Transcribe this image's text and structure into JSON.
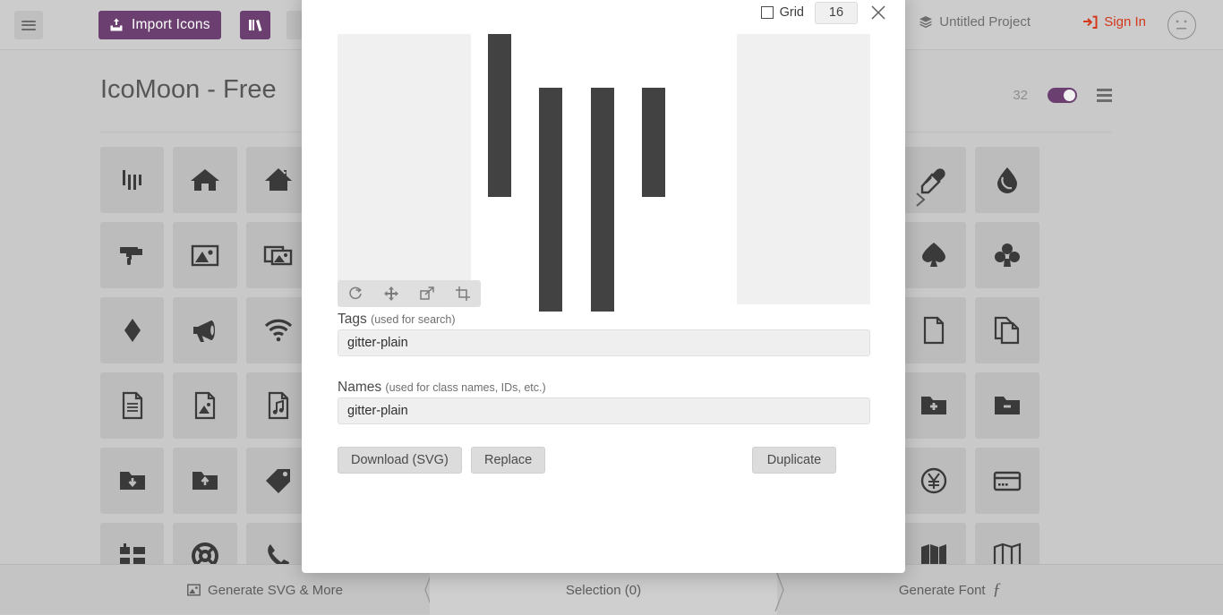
{
  "toolbar": {
    "menu_icon": "hamburger-menu-icon",
    "import_label": "Import Icons",
    "import_icon": "upload-box-icon",
    "library_icon": "books-library-icon",
    "project_label": "Untitled Project",
    "project_icon": "layers-icon",
    "signin_label": "Sign In",
    "signin_icon": "login-arrow-icon",
    "avatar_icon": "neutral-face-avatar-icon"
  },
  "set": {
    "title": "IcoMoon - Free",
    "grid_size": "32",
    "toggle_state": "on",
    "list_icon": "list-view-icon"
  },
  "icon_grid": {
    "left_icons": [
      "gitter-plain-icon",
      "home-icon",
      "home2-icon",
      "paint-roller-icon",
      "image-icon",
      "images-icon",
      "diamond-icon",
      "bullhorn-icon",
      "connection-wifi-icon",
      "file-text-icon",
      "file-picture-icon",
      "file-music-icon",
      "folder-download-icon",
      "folder-upload-icon",
      "price-tag-icon",
      "list-numbered-icon",
      "support-lifebuoy-icon",
      "phone-icon"
    ],
    "right_icons": [
      "eyedropper-icon",
      "droplet-icon",
      "spades-icon",
      "clubs-icon",
      "file-empty-icon",
      "files-empty-icon",
      "folder-plus-icon",
      "folder-minus-icon",
      "yen-coin-icon",
      "credit-card-icon",
      "map-filled-icon",
      "map-outline-icon"
    ]
  },
  "bottombar": {
    "generate_svg_label": "Generate SVG & More",
    "generate_svg_icon": "image-icon",
    "selection_label": "Selection (0)",
    "generate_font_label": "Generate Font",
    "generate_font_icon": "font-f-icon"
  },
  "modal": {
    "grid_checkbox_label": "Grid",
    "grid_checkbox_checked": false,
    "grid_value": "16",
    "close_icon": "close-x-icon",
    "next_icon": "chevron-right-icon",
    "edit_tools": [
      {
        "name": "rotate-icon"
      },
      {
        "name": "move-icon"
      },
      {
        "name": "scale-arrow-icon"
      },
      {
        "name": "crop-icon"
      }
    ],
    "tags_label": "Tags",
    "tags_hint": "(used for search)",
    "tags_value": "gitter-plain",
    "tags_placeholder": "Tags",
    "names_label": "Names",
    "names_hint": "(used for class names, IDs, etc.)",
    "names_value": "gitter-plain",
    "names_placeholder": "Names",
    "download_label": "Download (SVG)",
    "replace_label": "Replace",
    "duplicate_label": "Duplicate",
    "preview_icon": "gitter-plain-icon"
  },
  "colors": {
    "accent_purple": "#6b4070",
    "signin_red": "#d3381c",
    "app_bg": "#c9c9c9",
    "icon_cell": "#bcbcbc",
    "glyph": "#3a3a3a",
    "modal_bg": "#ffffff",
    "ghost_panel": "#f0f0f0"
  }
}
